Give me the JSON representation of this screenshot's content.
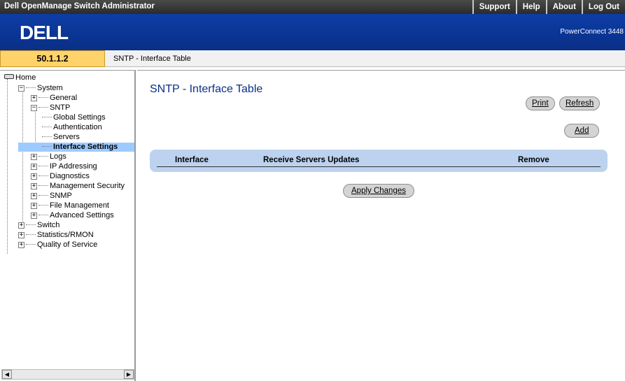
{
  "titlebar": {
    "title": "Dell OpenManage Switch Administrator",
    "links": [
      "Support",
      "Help",
      "About",
      "Log Out"
    ]
  },
  "banner": {
    "logo_text": "DELL",
    "product": "PowerConnect 3448"
  },
  "address": {
    "ip": "50.1.1.2",
    "breadcrumb": "SNTP - Interface Table"
  },
  "tree": {
    "home": "Home",
    "system": "System",
    "general": "General",
    "sntp": "SNTP",
    "sntp_children": [
      "Global Settings",
      "Authentication",
      "Servers",
      "Interface Settings"
    ],
    "logs": "Logs",
    "ip_addressing": "IP Addressing",
    "diagnostics": "Diagnostics",
    "management_security": "Management Security",
    "snmp": "SNMP",
    "file_management": "File Management",
    "advanced_settings": "Advanced Settings",
    "switch": "Switch",
    "statistics": "Statistics/RMON",
    "qos": "Quality of Service"
  },
  "content": {
    "title": "SNTP - Interface Table",
    "print_label": "Print",
    "refresh_label": "Refresh",
    "add_label": "Add",
    "columns": [
      "Interface",
      "Receive Servers Updates",
      "Remove"
    ],
    "apply_label": "Apply Changes"
  },
  "colors": {
    "banner": "#0a2f86",
    "ip_box": "#ffd36a",
    "selected": "#9ecbff",
    "table_header": "#bcd2ef"
  }
}
